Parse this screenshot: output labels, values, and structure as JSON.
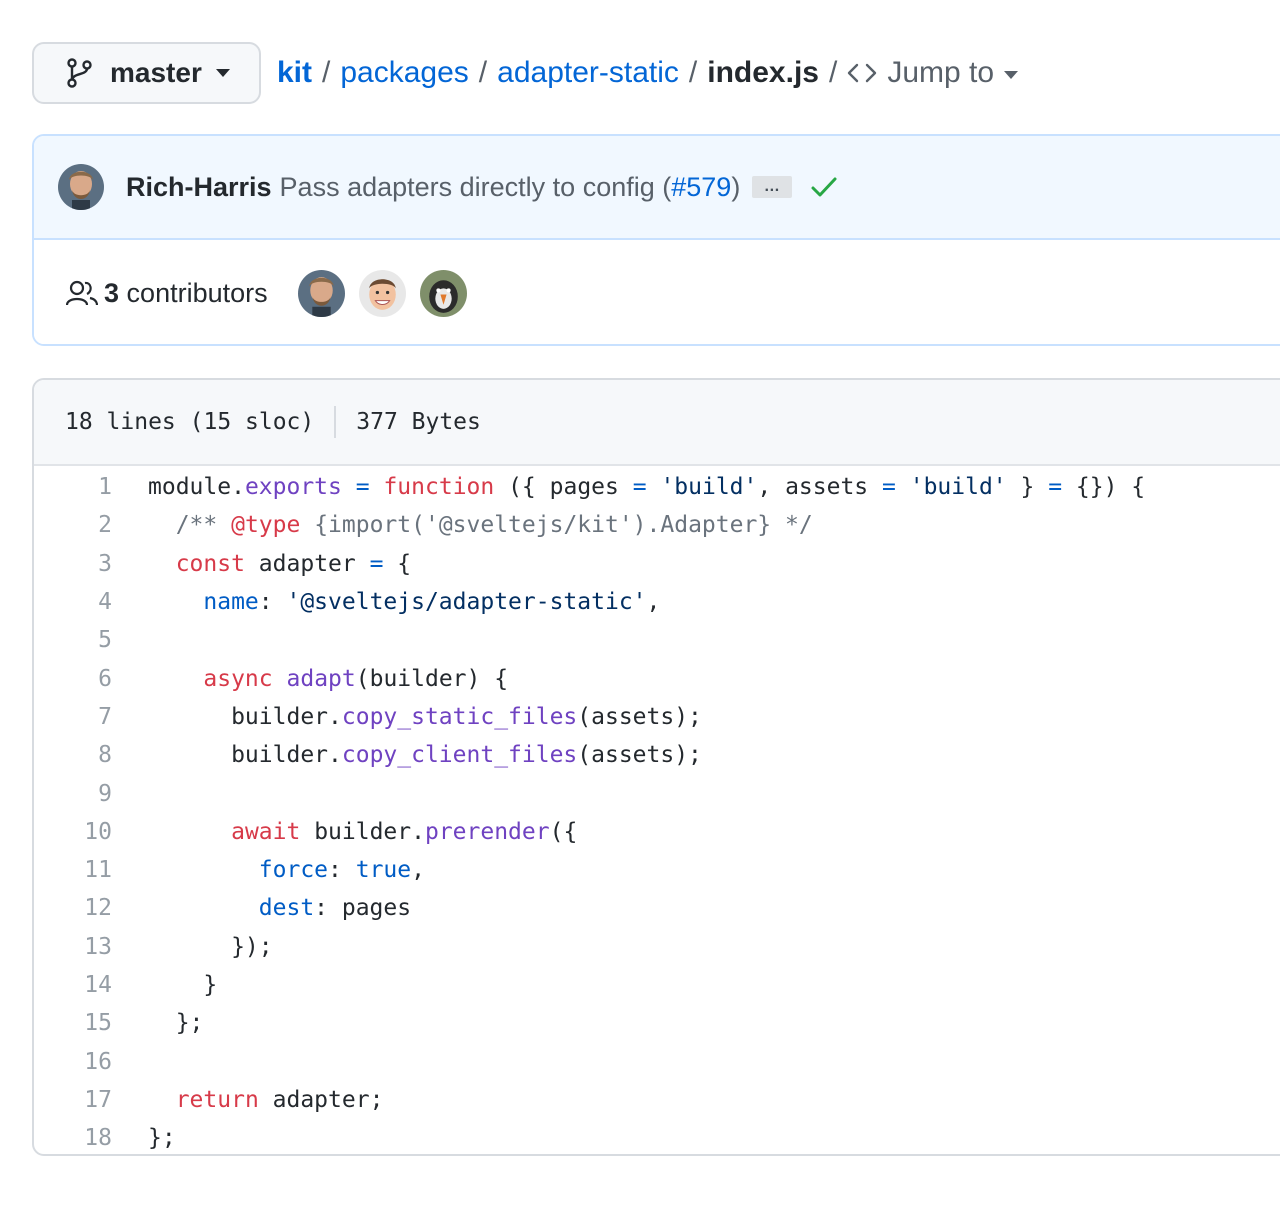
{
  "branch": {
    "label": "master"
  },
  "breadcrumb": {
    "repo": "kit",
    "folder1": "packages",
    "folder2": "adapter-static",
    "file": "index.js",
    "separator": "/",
    "jump_label": "Jump to"
  },
  "commit": {
    "author": "Rich-Harris",
    "message": "Pass adapters directly to config (",
    "pr": "#579",
    "message_end": ")",
    "ellipsis": "…",
    "status": "success"
  },
  "contributors": {
    "count": "3",
    "label": "contributors"
  },
  "file": {
    "lines_info": "18 lines (15 sloc)",
    "size": "377 Bytes"
  },
  "code_lines": [
    [
      [
        "t",
        "module."
      ],
      [
        "fn",
        "exports"
      ],
      [
        "t",
        " "
      ],
      [
        "pr",
        "="
      ],
      [
        "t",
        " "
      ],
      [
        "kw",
        "function"
      ],
      [
        "t",
        " ({ pages "
      ],
      [
        "pr",
        "="
      ],
      [
        "t",
        " "
      ],
      [
        "st",
        "'build'"
      ],
      [
        "t",
        ", assets "
      ],
      [
        "pr",
        "="
      ],
      [
        "t",
        " "
      ],
      [
        "st",
        "'build'"
      ],
      [
        "t",
        " } "
      ],
      [
        "pr",
        "="
      ],
      [
        "t",
        " {}) {"
      ]
    ],
    [
      [
        "t",
        "  "
      ],
      [
        "cm",
        "/** "
      ],
      [
        "kw",
        "@type"
      ],
      [
        "cm",
        " {import('@sveltejs/kit').Adapter} */"
      ]
    ],
    [
      [
        "t",
        "  "
      ],
      [
        "kw",
        "const"
      ],
      [
        "t",
        " adapter "
      ],
      [
        "pr",
        "="
      ],
      [
        "t",
        " {"
      ]
    ],
    [
      [
        "t",
        "    "
      ],
      [
        "pr",
        "name"
      ],
      [
        "t",
        ": "
      ],
      [
        "st",
        "'@sveltejs/adapter-static'"
      ],
      [
        "t",
        ","
      ]
    ],
    [],
    [
      [
        "t",
        "    "
      ],
      [
        "kw",
        "async"
      ],
      [
        "t",
        " "
      ],
      [
        "fn",
        "adapt"
      ],
      [
        "t",
        "(builder) {"
      ]
    ],
    [
      [
        "t",
        "      builder."
      ],
      [
        "fn",
        "copy_static_files"
      ],
      [
        "t",
        "(assets);"
      ]
    ],
    [
      [
        "t",
        "      builder."
      ],
      [
        "fn",
        "copy_client_files"
      ],
      [
        "t",
        "(assets);"
      ]
    ],
    [],
    [
      [
        "t",
        "      "
      ],
      [
        "kw",
        "await"
      ],
      [
        "t",
        " builder."
      ],
      [
        "fn",
        "prerender"
      ],
      [
        "t",
        "({"
      ]
    ],
    [
      [
        "t",
        "        "
      ],
      [
        "pr",
        "force"
      ],
      [
        "t",
        ": "
      ],
      [
        "pr",
        "true"
      ],
      [
        "t",
        ","
      ]
    ],
    [
      [
        "t",
        "        "
      ],
      [
        "pr",
        "dest"
      ],
      [
        "t",
        ": pages"
      ]
    ],
    [
      [
        "t",
        "      });"
      ]
    ],
    [
      [
        "t",
        "    }"
      ]
    ],
    [
      [
        "t",
        "  };"
      ]
    ],
    [],
    [
      [
        "t",
        "  "
      ],
      [
        "kw",
        "return"
      ],
      [
        "t",
        " adapter;"
      ]
    ],
    [
      [
        "t",
        "};"
      ]
    ]
  ]
}
